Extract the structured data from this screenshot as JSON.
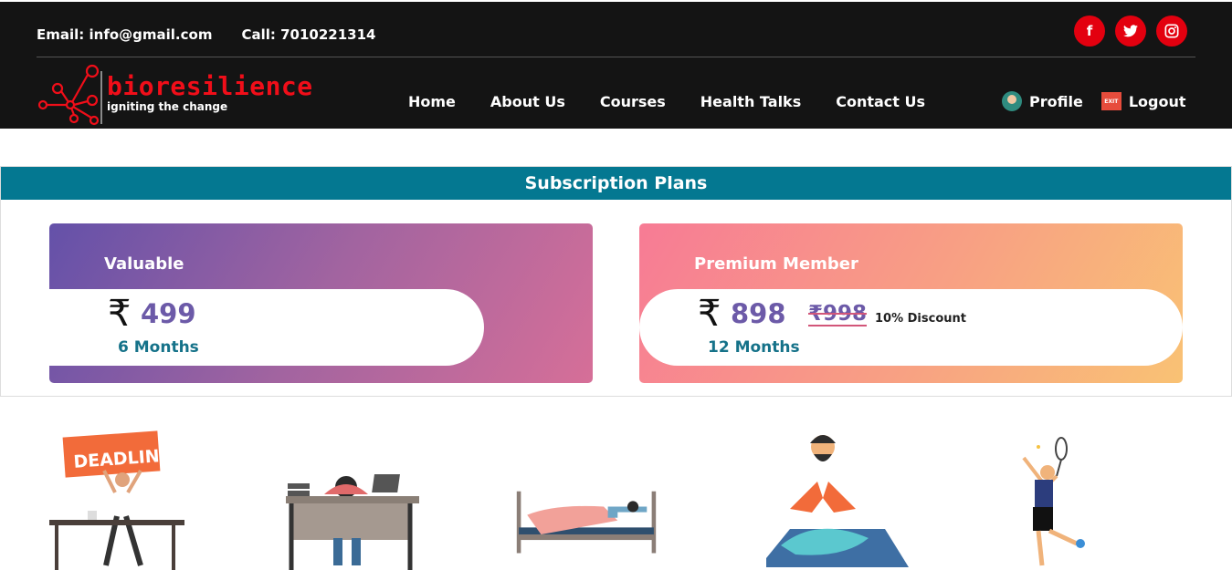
{
  "header": {
    "email": "Email: info@gmail.com",
    "call": "Call: 7010221314",
    "social": [
      "f",
      "t",
      "ig"
    ],
    "brand": "bioresilience",
    "tagline": "igniting the change",
    "nav": [
      "Home",
      "About Us",
      "Courses",
      "Health Talks",
      "Contact Us"
    ],
    "profile": "Profile",
    "logout": "Logout",
    "exit_sign": "EXIT"
  },
  "plans": {
    "title": "Subscription Plans",
    "cards": [
      {
        "name": "Valuable",
        "currency": "₹",
        "price": "499",
        "duration": "6 Months"
      },
      {
        "name": "Premium Member",
        "currency": "₹",
        "price": "898",
        "old_price": "₹998",
        "discount": "10% Discount",
        "duration": "12 Months"
      }
    ]
  },
  "illustrations": {
    "deadline_sign": "DEADLINE"
  },
  "colors": {
    "header_bg": "#141414",
    "brand_red": "#f00e19",
    "plans_bar": "#047891"
  }
}
